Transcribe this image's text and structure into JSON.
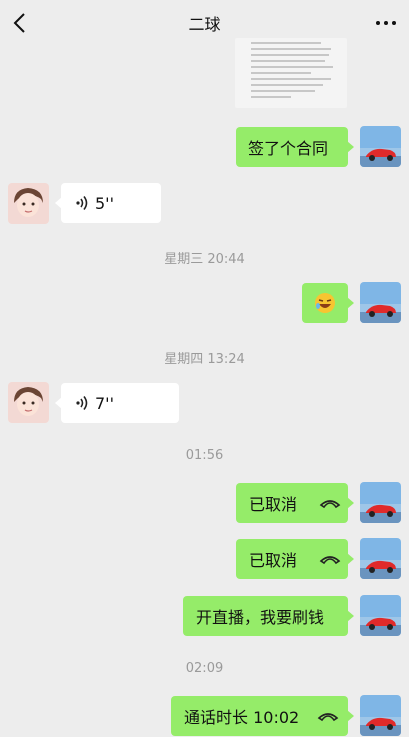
{
  "header": {
    "title": "二球"
  },
  "messages": {
    "m1": "签了个合同",
    "m2_duration": "5''",
    "ts1": "星期三 20:44",
    "ts2": "星期四 13:24",
    "m4_duration": "7''",
    "ts3": "01:56",
    "m5": "已取消",
    "m6": "已取消",
    "m7": "开直播，我要刷钱",
    "ts4": "02:09",
    "m8": "通话时长 10:02"
  },
  "colors": {
    "bg": "#ededed",
    "self_bubble": "#95ec69",
    "friend_bubble": "#ffffff",
    "timestamp": "#9a9a9a"
  },
  "icons": {
    "back": "chevron-left-icon",
    "more": "more-dots-icon",
    "voice": "voice-wave-icon",
    "call": "phone-hangup-icon",
    "emoji": "laughing-emoji-icon"
  }
}
